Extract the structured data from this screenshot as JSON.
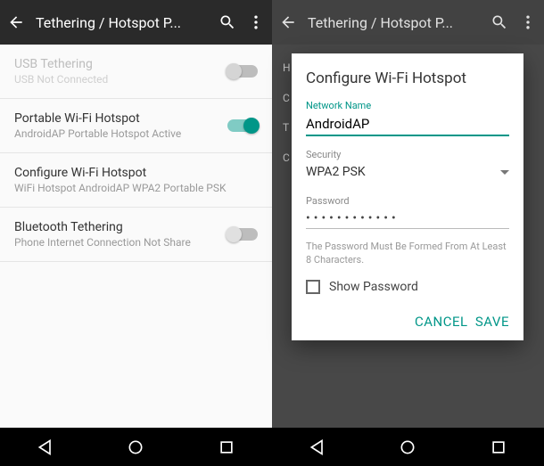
{
  "left": {
    "toolbar": {
      "title": "Tethering / Hotspot P..."
    },
    "rows": [
      {
        "title": "USB Tethering",
        "subtitle": "USB Not Connected"
      },
      {
        "title": "Portable Wi-Fi Hotspot",
        "subtitle": "AndroidAP Portable Hotspot Active"
      },
      {
        "title": "Configure Wi-Fi Hotspot",
        "subtitle": "WiFi Hotspot AndroidAP WPA2 Portable PSK"
      },
      {
        "title": "Bluetooth Tethering",
        "subtitle": "Phone Internet Connection Not Share"
      }
    ]
  },
  "right": {
    "toolbar": {
      "title": "Tethering / Hotspot P..."
    },
    "bg_hints": {
      "h": "H",
      "c": "C",
      "t": "T",
      "c2": "C"
    },
    "dialog": {
      "title": "Configure Wi-Fi Hotspot",
      "network_label": "Network Name",
      "network_value": "AndroidAP",
      "security_label": "Security",
      "security_value": "WPA2 PSK",
      "password_label": "Password",
      "password_value": "••••••••••••",
      "helper": "The Password Must Be Formed From At Least 8 Characters.",
      "show_pw": "Show Password",
      "cancel": "CANCEL",
      "save": "SAVE"
    }
  }
}
